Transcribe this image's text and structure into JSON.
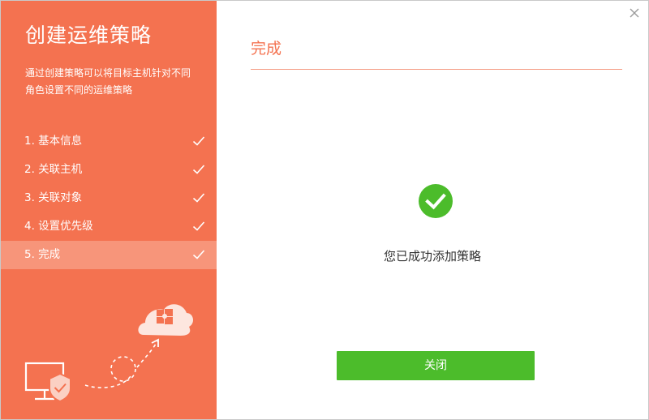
{
  "sidebar": {
    "title": "创建运维策略",
    "description": "通过创建策略可以将目标主机针对不同角色设置不同的运维策略",
    "steps": [
      {
        "label": "1. 基本信息",
        "done": true
      },
      {
        "label": "2. 关联主机",
        "done": true
      },
      {
        "label": "3. 关联对象",
        "done": true
      },
      {
        "label": "4. 设置优先级",
        "done": true
      },
      {
        "label": "5. 完成",
        "done": true,
        "active": true
      }
    ]
  },
  "main": {
    "title": "完成",
    "success_message": "您已成功添加策略",
    "close_button": "关闭"
  },
  "colors": {
    "sidebar_bg": "#f47250",
    "active_step_bg": "#f7957a",
    "accent": "#f47250",
    "success": "#4cbc2b"
  },
  "icons": {
    "step_done": "check-icon",
    "window_close": "close-x-icon",
    "success": "check-circle-icon",
    "illustration": [
      "monitor-icon",
      "shield-check-icon",
      "cloud-windows-icon"
    ]
  }
}
